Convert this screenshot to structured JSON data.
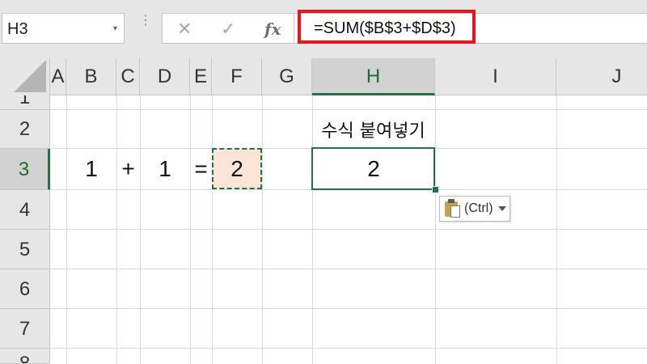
{
  "formula_bar": {
    "name_box": "H3",
    "name_box_caret": "▾",
    "dots": "⋮",
    "cancel_icon": "✕",
    "enter_icon": "✓",
    "fx_label": "fx",
    "formula": "=SUM($B$3+$D$3)",
    "highlight_color": "#e8161c"
  },
  "columns": [
    "A",
    "B",
    "C",
    "D",
    "E",
    "F",
    "G",
    "H",
    "I",
    "J"
  ],
  "selected_column": "H",
  "rows": [
    "1",
    "2",
    "3",
    "4",
    "5",
    "6",
    "7",
    "8"
  ],
  "selected_row": "3",
  "cells": {
    "B3": "1",
    "C3": "+",
    "D3": "1",
    "E3": "=",
    "F3": "2",
    "H2": "수식 붙여넣기",
    "H3": "2"
  },
  "paste_options": {
    "label": "(Ctrl)",
    "icon": "clipboard-icon"
  },
  "colors": {
    "accent": "#217346",
    "copied_fill": "#fce4d6"
  }
}
